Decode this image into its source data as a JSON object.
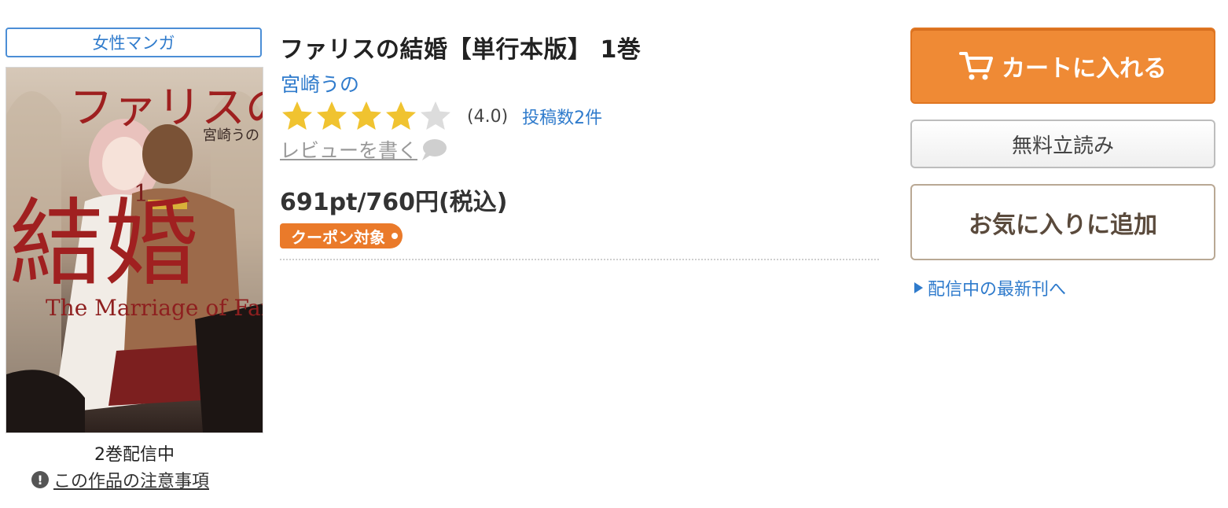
{
  "genre": "女性マンガ",
  "cover": {
    "title_jp_top": "ファリスの",
    "title_jp_bottom": "結婚",
    "author_jp": "宮崎うの",
    "subtitle_en": "The Marriage of Faris",
    "volume_mark": "1"
  },
  "volumes_available": "2巻配信中",
  "caution": {
    "icon": "!",
    "label": "この作品の注意事項"
  },
  "title": "ファリスの結婚【単行本版】 1巻",
  "author": "宮崎うの",
  "rating": {
    "value": 4.0,
    "max": 5,
    "value_text": "(4.0)",
    "count_label": "投稿数2件"
  },
  "write_review_label": "レビューを書く",
  "price": "691pt/760円(税込)",
  "coupon_label": "クーポン対象",
  "buttons": {
    "cart": "カートに入れる",
    "trial": "無料立読み",
    "favorite": "お気に入りに追加"
  },
  "latest_link": "配信中の最新刊へ",
  "colors": {
    "accent_orange": "#ef8a35",
    "link_blue": "#2f7bcc",
    "star_gold": "#f0c330",
    "star_empty": "#dcdcdc"
  }
}
